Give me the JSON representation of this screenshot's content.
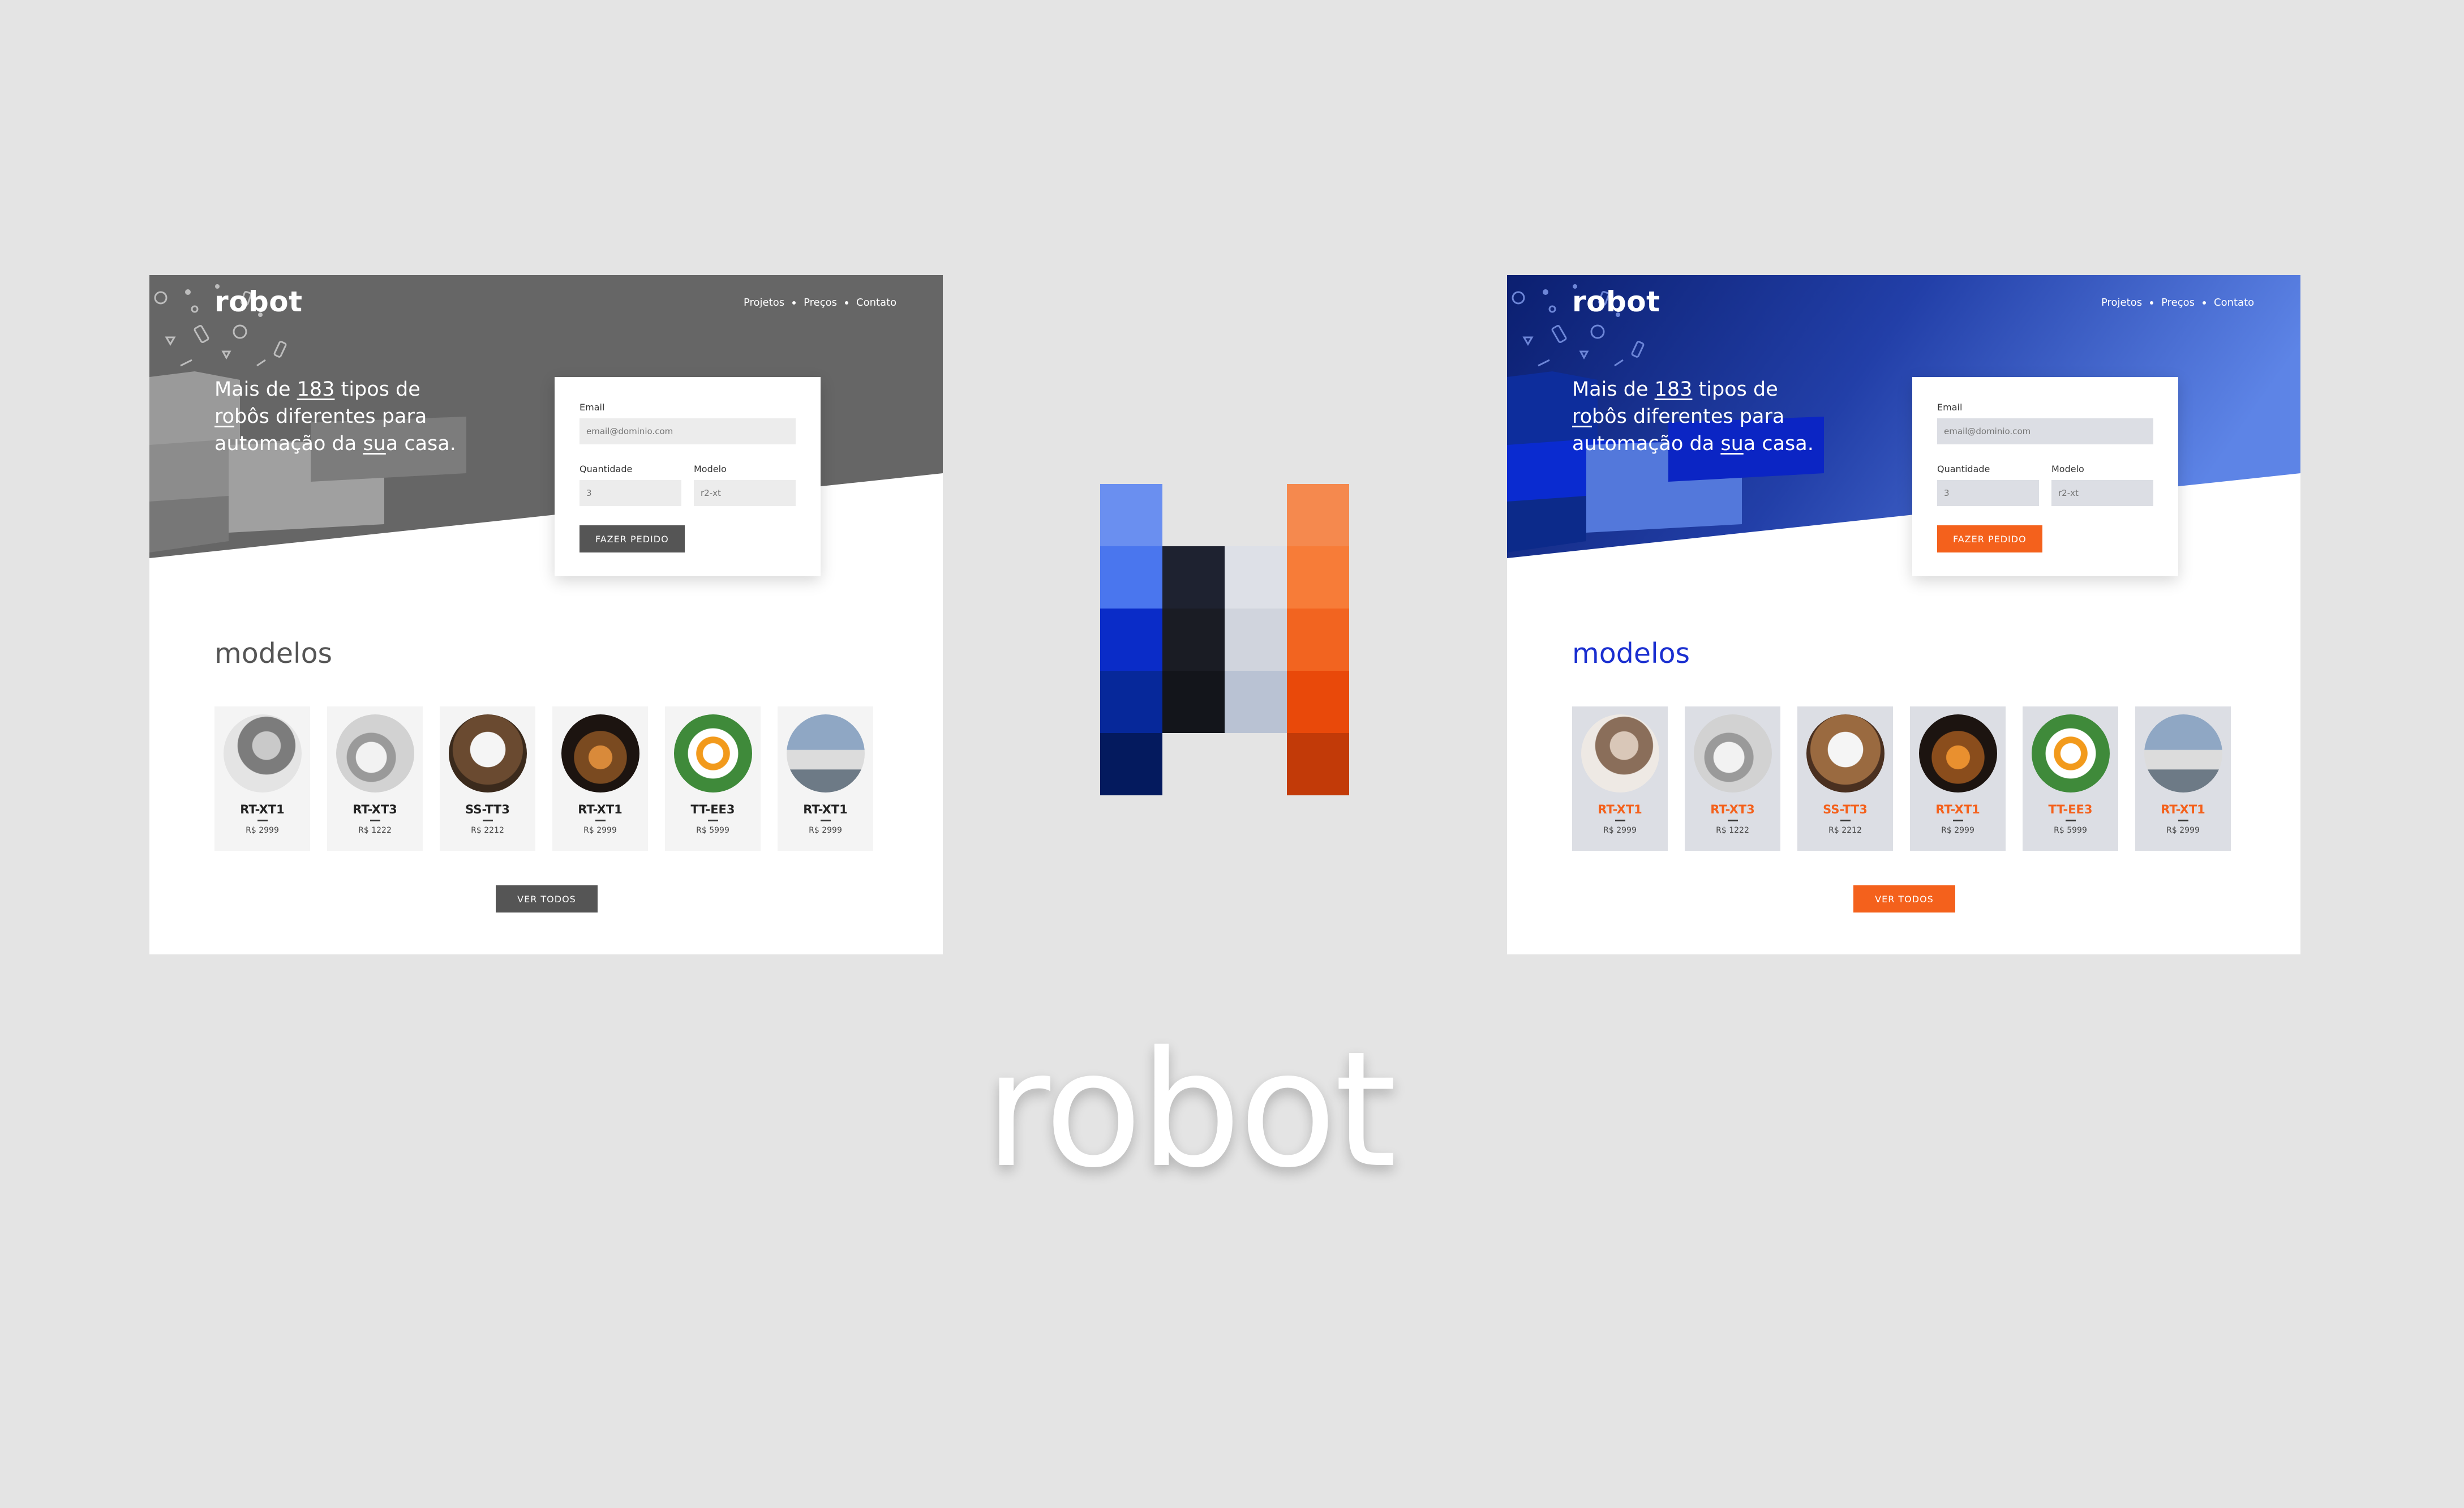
{
  "brand": "robot",
  "nav": [
    "Projetos",
    "Preços",
    "Contato"
  ],
  "headline": {
    "line1_a": "Mais de ",
    "line1_u": "183",
    "line1_b": " tipos de",
    "line2_u": "ro",
    "line2_b": "bôs diferentes para",
    "line3_a": "automação da ",
    "line3_u": "su",
    "line3_b": "a casa."
  },
  "form": {
    "email_label": "Email",
    "email_placeholder": "email@dominio.com",
    "quantity_label": "Quantidade",
    "quantity_placeholder": "3",
    "model_label": "Modelo",
    "model_placeholder": "r2-xt",
    "submit_label": "FAZER PEDIDO"
  },
  "models_title": "modelos",
  "models": [
    {
      "name": "RT-XT1",
      "price": "R$ 2999"
    },
    {
      "name": "RT-XT3",
      "price": "R$ 1222"
    },
    {
      "name": "SS-TT3",
      "price": "R$ 2212"
    },
    {
      "name": "RT-XT1",
      "price": "R$ 2999"
    },
    {
      "name": "TT-EE3",
      "price": "R$ 5999"
    },
    {
      "name": "RT-XT1",
      "price": "R$ 2999"
    }
  ],
  "cta_label": "VER TODOS",
  "wordmark": "robot",
  "colors": {
    "gray_hero": "#666666",
    "gray_accent": "#555555",
    "blue_dark": "#0b1f70",
    "blue_light": "#5d84e6",
    "blue_title": "#1a2fd0",
    "orange": "#f4611c",
    "card_bg_color": "#dcdee4"
  },
  "palette": {
    "blues": [
      "#6a8ff0",
      "#4a76ee",
      "#0a2cc8",
      "#06289a",
      "#041a5e"
    ],
    "darks": [
      "#1e2230",
      "#1a1c24",
      "#13151b"
    ],
    "lights": [
      "#dde0e7",
      "#d0d4dd",
      "#b9c2d3"
    ],
    "oranges": [
      "#f5894e",
      "#f77c38",
      "#f26420",
      "#e9490a",
      "#c23a08"
    ]
  }
}
